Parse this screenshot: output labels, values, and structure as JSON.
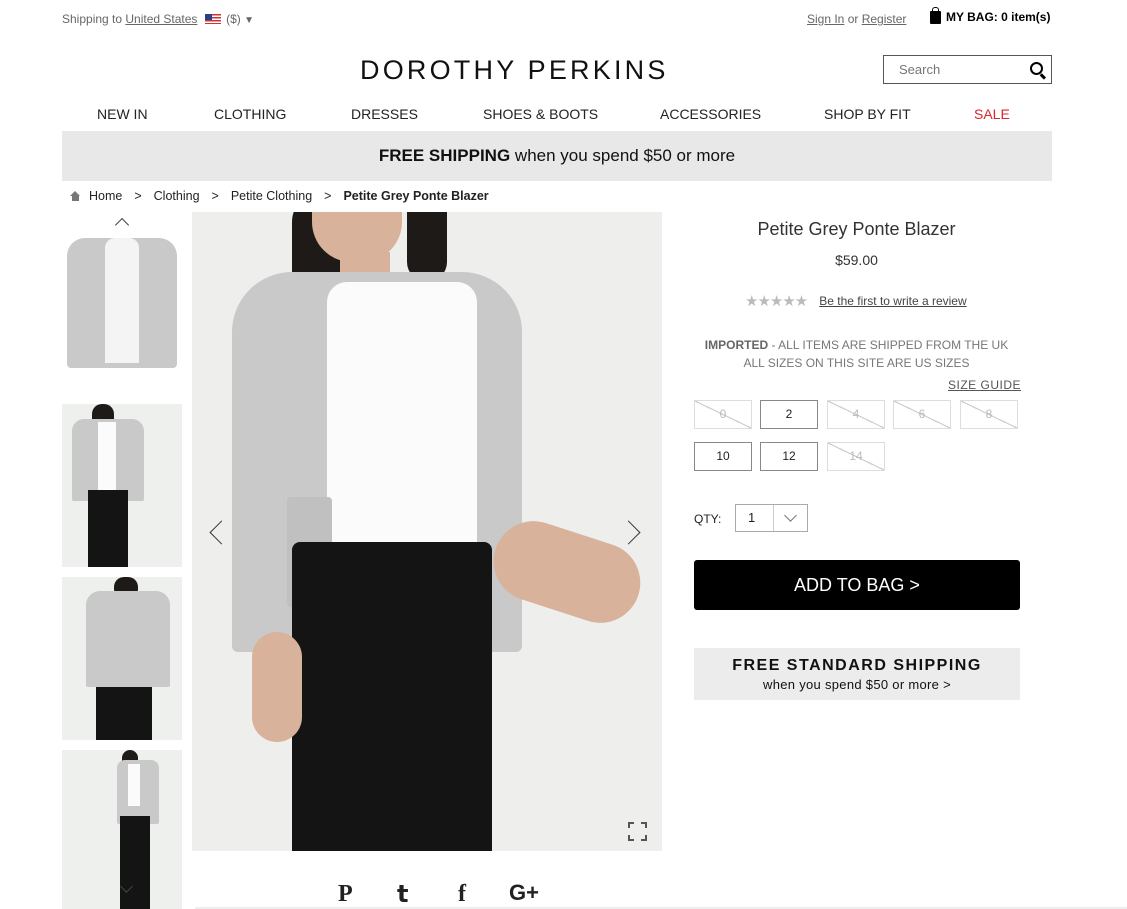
{
  "topbar": {
    "shipping_prefix": "Shipping to",
    "shipping_country": "United States",
    "currency": "($)",
    "sign_in": "Sign In",
    "or": "or",
    "register": "Register",
    "bag": "MY BAG: 0 item(s)"
  },
  "header": {
    "logo": "DOROTHY PERKINS",
    "search_placeholder": "Search"
  },
  "nav": [
    "NEW IN",
    "CLOTHING",
    "DRESSES",
    "SHOES & BOOTS",
    "ACCESSORIES",
    "SHOP BY FIT",
    "SALE"
  ],
  "promo": {
    "bold": "FREE SHIPPING",
    "rest": "when you spend $50 or more"
  },
  "breadcrumb": {
    "items": [
      "Home",
      "Clothing",
      "Petite Clothing",
      "Petite Grey Ponte Blazer"
    ],
    "separator": ">"
  },
  "product": {
    "title": "Petite Grey Ponte Blazer",
    "price": "$59.00",
    "stars": "★★★★★",
    "review_link": "Be the first to write a review",
    "imported_bold": "IMPORTED",
    "imported_rest": "- ALL ITEMS ARE SHIPPED FROM THE UK",
    "sizes_note": "ALL SIZES ON THIS SITE ARE US SIZES",
    "size_guide": "SIZE GUIDE",
    "sizes": [
      {
        "label": "0",
        "available": false
      },
      {
        "label": "2",
        "available": true
      },
      {
        "label": "4",
        "available": false
      },
      {
        "label": "6",
        "available": false
      },
      {
        "label": "8",
        "available": false
      },
      {
        "label": "10",
        "available": true
      },
      {
        "label": "12",
        "available": true
      },
      {
        "label": "14",
        "available": false
      }
    ],
    "qty_label": "QTY:",
    "qty_value": "1",
    "add_to_bag": "ADD TO BAG >",
    "ship_title": "FREE STANDARD SHIPPING",
    "ship_sub": "when you spend $50 or more >"
  },
  "social": {
    "pinterest": "P",
    "twitter": "t",
    "facebook": "f",
    "googleplus": "G+"
  }
}
